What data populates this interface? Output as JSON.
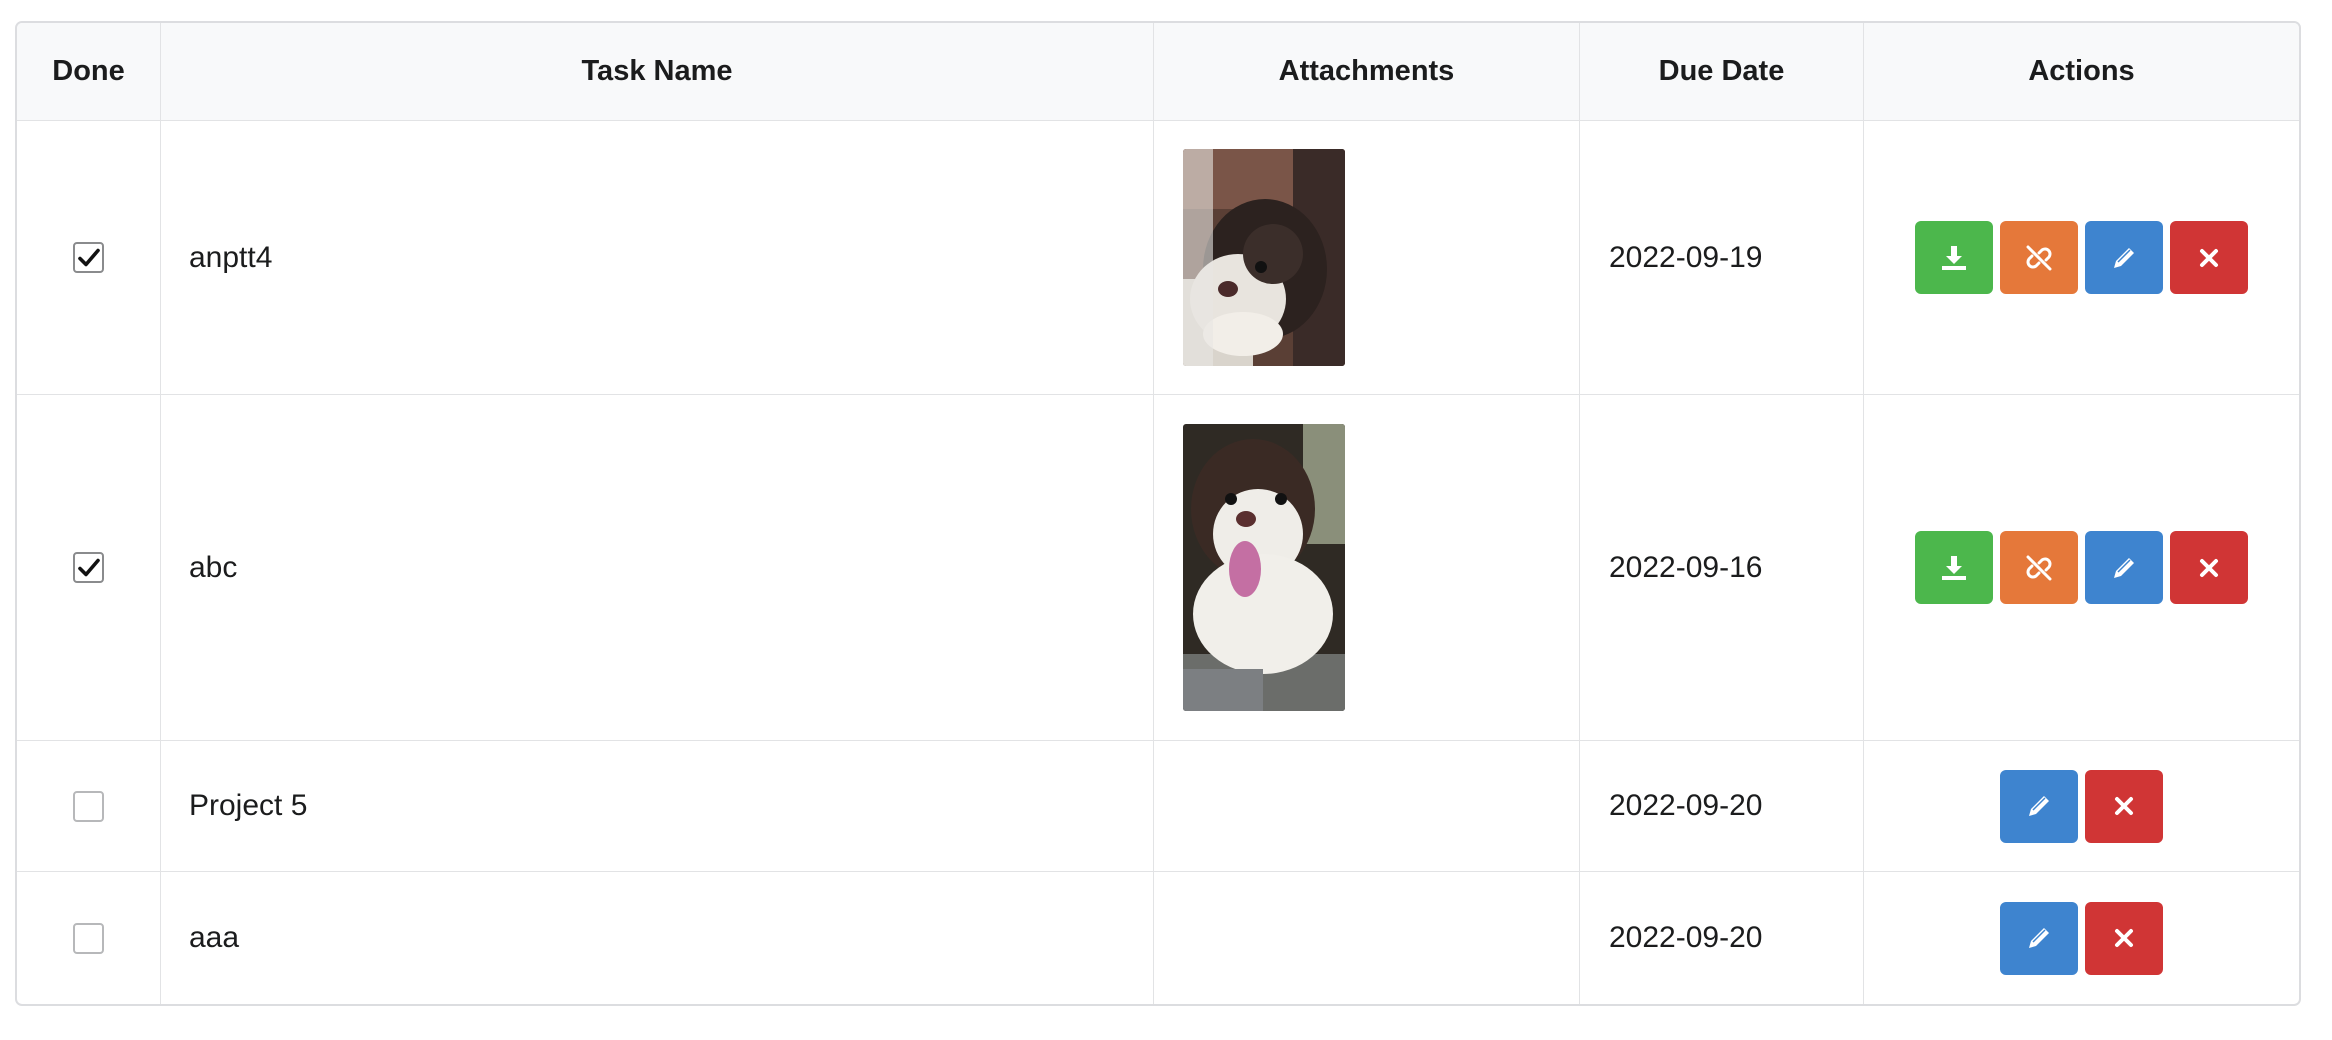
{
  "table": {
    "headers": {
      "done": "Done",
      "task_name": "Task Name",
      "attachments": "Attachments",
      "due_date": "Due Date",
      "actions": "Actions"
    },
    "rows": [
      {
        "done": true,
        "task_name": "anptt4",
        "attachment": "dog-photo-lying",
        "due_date": "2022-09-19",
        "actions": [
          "download",
          "unlink",
          "edit",
          "delete"
        ]
      },
      {
        "done": true,
        "task_name": "abc",
        "attachment": "dog-photo-tongue-out",
        "due_date": "2022-09-16",
        "actions": [
          "download",
          "unlink",
          "edit",
          "delete"
        ]
      },
      {
        "done": false,
        "task_name": "Project 5",
        "attachment": null,
        "due_date": "2022-09-20",
        "actions": [
          "edit",
          "delete"
        ]
      },
      {
        "done": false,
        "task_name": "aaa",
        "attachment": null,
        "due_date": "2022-09-20",
        "actions": [
          "edit",
          "delete"
        ]
      }
    ]
  },
  "icons": {
    "download": "download-icon",
    "unlink": "unlink-icon",
    "edit": "pencil-icon",
    "delete": "close-icon",
    "check": "checkmark-icon"
  },
  "colors": {
    "download_button": "#4cb74c",
    "unlink_button": "#e5783a",
    "edit_button": "#3e84cf",
    "delete_button": "#d03535",
    "header_background": "#f8f9fa",
    "border": "#dcdde0"
  }
}
